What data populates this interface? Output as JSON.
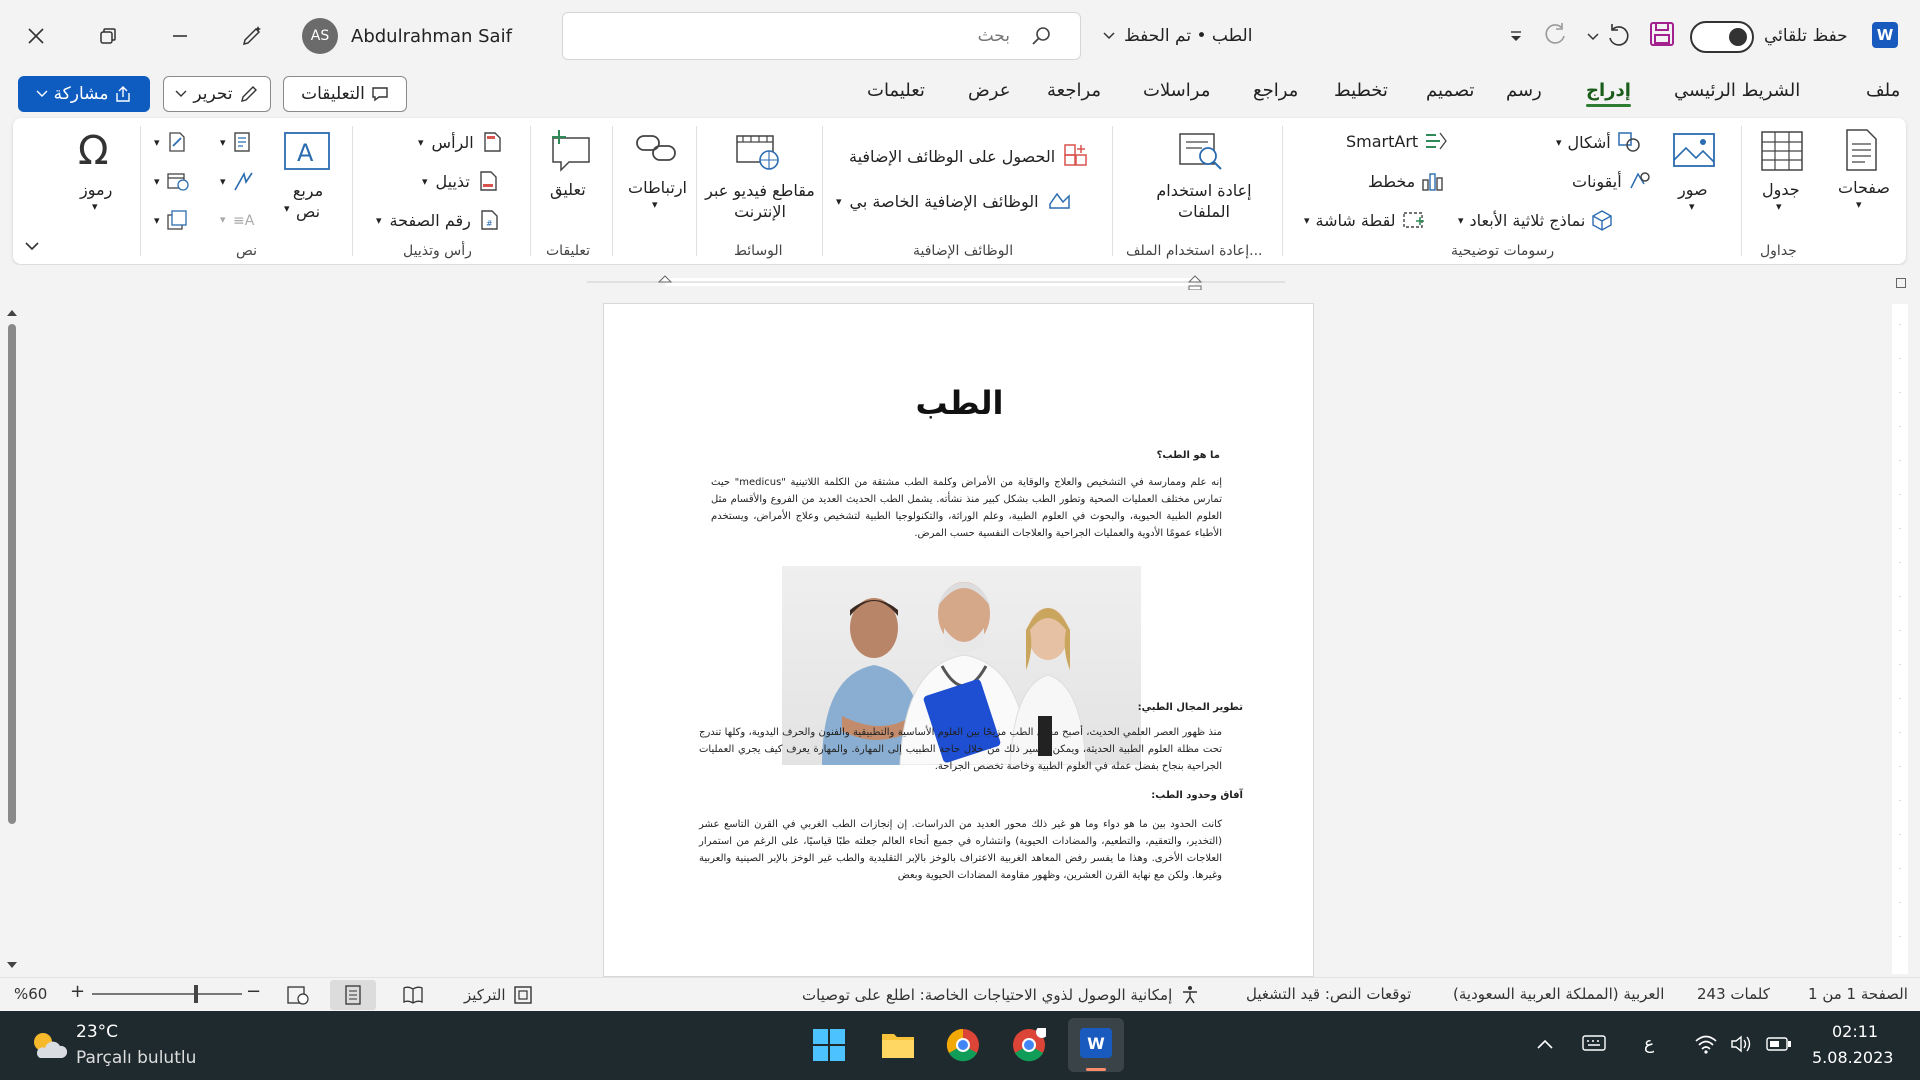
{
  "titlebar": {
    "autosave_label": "حفظ تلقائي",
    "doc_title": "الطب • تم الحفظ",
    "search_placeholder": "بحث",
    "user_name": "Abdulrahman  Saif",
    "user_initials": "AS"
  },
  "tabs": [
    "ملف",
    "الشريط الرئيسي",
    "إدراج",
    "رسم",
    "تصميم",
    "تخطيط",
    "مراجع",
    "مراسلات",
    "مراجعة",
    "عرض",
    "تعليمات"
  ],
  "active_tab": "إدراج",
  "actions": {
    "comments": "التعليقات",
    "edit": "تحرير",
    "share": "مشاركة"
  },
  "ribbon": {
    "pages": "صفحات",
    "table": "جدول",
    "pictures": "صور",
    "shapes": "أشكال",
    "icons": "أيقونات",
    "models_3d": "نماذج ثلاثية الأبعاد",
    "smartart": "SmartArt",
    "chart": "مخطط",
    "screenshot": "لقطة شاشة",
    "reuse_files": "إعادة استخدام الملفات",
    "get_addins": "الحصول على الوظائف الإضافية",
    "my_addins": "الوظائف الإضافية الخاصة بي",
    "online_video": "مقاطع فيديو عبر الإنترنت",
    "links": "ارتباطات",
    "comment": "تعليق",
    "header": "الرأس",
    "footer": "تذييل",
    "page_number": "رقم الصفحة",
    "textbox": "مربع نص",
    "symbols": "رموز",
    "groups": {
      "tables": "جداول",
      "illustrations": "رسومات توضيحية",
      "reuse": "إعادة استخدام الملف...",
      "addins": "الوظائف الإضافية",
      "media": "الوسائط",
      "comments": "تعليقات",
      "header_footer": "رأس وتذييل",
      "text": "نص"
    }
  },
  "document": {
    "title": "الطب",
    "h1": "ما هو الطب؟",
    "p1": "إنه علم وممارسة في التشخيص والعلاج والوقاية من الأمراض وكلمة الطب مشتقة من الكلمة اللاتينية \"medicus\" حيث تمارس مختلف العمليات الصحية وتطور الطب بشكل كبير منذ نشأته. يشمل الطب الحديث العديد من الفروع والأقسام مثل العلوم الطبية الحيوية، والبحوث في العلوم الطبية، وعلم الوراثة، والتكنولوجيا الطبية لتشخيص وعلاج الأمراض، ويستخدم الأطباء عمومًا الأدوية والعمليات الجراحية والعلاجات النفسية حسب المرض.",
    "h2": "تطوير المجال الطبي:",
    "p2": "منذ ظهور العصر العلمي الحديث، أصبح مجال الطب مزيجًا بين العلوم الأساسية والتطبيقية والفنون والحرف اليدوية، وكلها تندرج تحت مظلة العلوم الطبية الحديثة، ويمكن تفسير ذلك من خلال حاجة الطبيب إلى المهارة. والمهارة يعرف كيف يجري العمليات الجراحية بنجاح بفضل عمله في العلوم الطبية وخاصة تخصص الجراحة.",
    "h3": "آفاق وحدود الطب:",
    "p3": "كانت الحدود بين ما هو دواء وما هو غير ذلك محور العديد من الدراسات. إن إنجازات الطب الغربي في القرن التاسع عشر (التخدير، والتعقيم، والتطعيم، والمضادات الحيوية) وانتشاره في جميع أنحاء العالم جعلته طبًا قياسيًا، على الرغم من استمرار العلاجات الأخرى. وهذا ما يفسر رفض المعاهد الغربية الاعتراف بالوخز بالإبر التقليدية والطب غير الوخز بالإبر الصينية والعربية وغيرها. ولكن مع نهاية القرن العشرين، وظهور مقاومة المضادات الحيوية وبعض"
  },
  "statusbar": {
    "page": "الصفحة 1 من 1",
    "words": "243 كلمات",
    "language": "العربية (المملكة العربية السعودية)",
    "predictions": "توقعات النص: قيد التشغيل",
    "accessibility": "إمكانية الوصول لذوي الاحتياجات الخاصة: اطلع على توصيات",
    "focus": "التركيز",
    "zoom": "%60"
  },
  "taskbar": {
    "temperature": "23°C",
    "weather": "Parçalı bulutlu",
    "time": "02:11",
    "date": "5.08.2023",
    "ime": "ع"
  }
}
